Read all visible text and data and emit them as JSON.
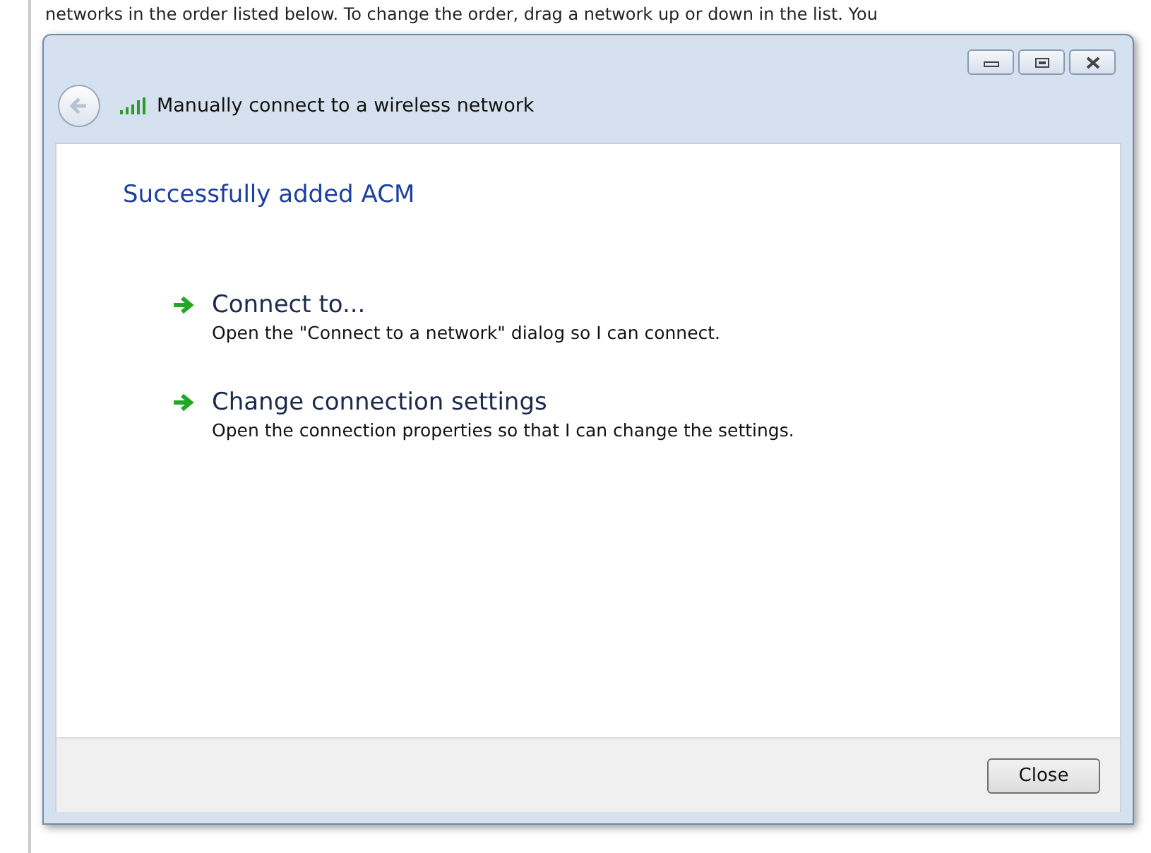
{
  "background_text": "networks in the order listed below. To change the order, drag a network up or down in the list. You",
  "window": {
    "title": "Manually connect to a wireless network"
  },
  "heading": "Successfully added ACM",
  "options": [
    {
      "title": "Connect to...",
      "description": "Open the \"Connect to a network\" dialog so I can connect."
    },
    {
      "title": "Change connection settings",
      "description": "Open the connection properties so that I can change the settings."
    }
  ],
  "buttons": [
    "Close"
  ]
}
